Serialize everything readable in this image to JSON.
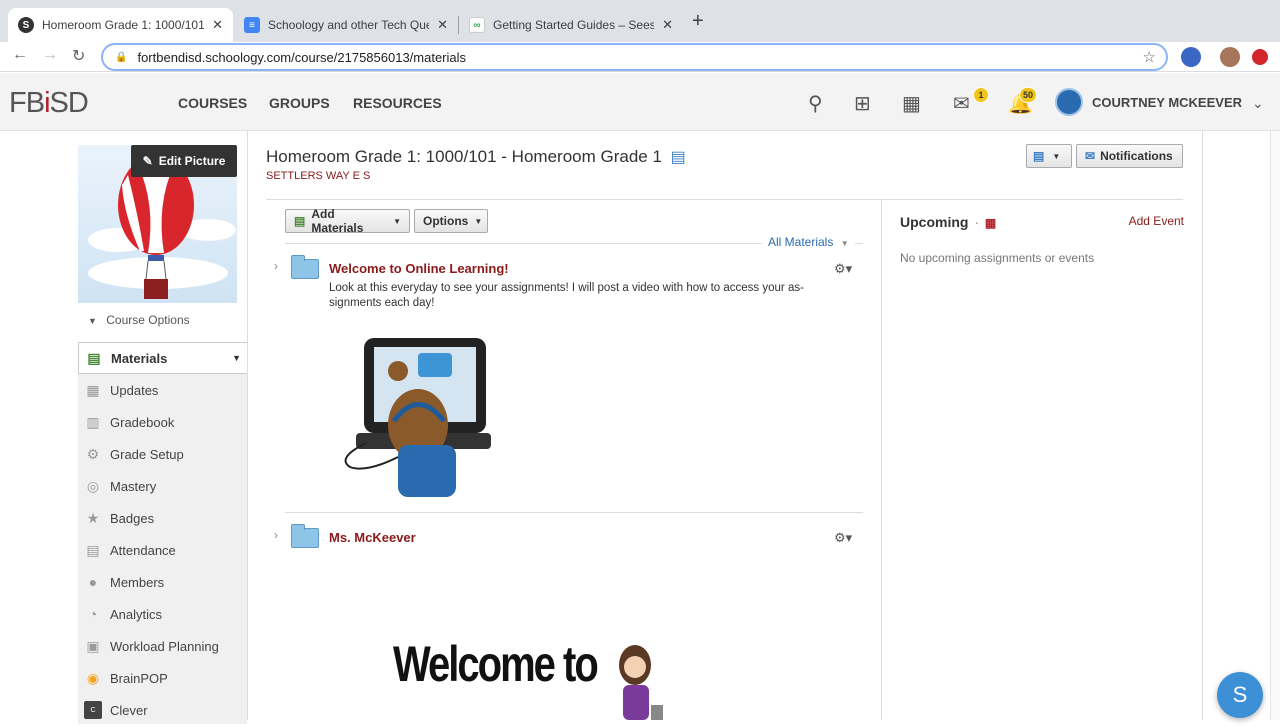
{
  "browser": {
    "tabs": [
      {
        "title": "Homeroom Grade 1: 1000/101 -",
        "favicon": "S",
        "favicon_color": "#1a73e8",
        "active": true
      },
      {
        "title": "Schoology and other Tech Que",
        "favicon": "doc",
        "favicon_color": "#4285f4",
        "active": false
      },
      {
        "title": "Getting Started Guides – Sees",
        "favicon": "seesaw",
        "favicon_color": "#34a853",
        "active": false
      }
    ],
    "url": "fortbendisd.schoology.com/course/2175856013/materials"
  },
  "header": {
    "logo_text_a": "FB",
    "logo_text_i": "i",
    "logo_text_b": "SD",
    "nav": [
      "COURSES",
      "GROUPS",
      "RESOURCES"
    ],
    "messages_badge": "1",
    "notifications_badge": "50",
    "user_name": "COURTNEY MCKEEVER"
  },
  "sidebar": {
    "edit_picture": "Edit Picture",
    "course_options": "Course Options",
    "items": [
      {
        "label": "Materials",
        "icon": "materials-icon"
      },
      {
        "label": "Updates",
        "icon": "updates-icon"
      },
      {
        "label": "Gradebook",
        "icon": "gradebook-icon"
      },
      {
        "label": "Grade Setup",
        "icon": "grade-setup-icon"
      },
      {
        "label": "Mastery",
        "icon": "mastery-icon"
      },
      {
        "label": "Badges",
        "icon": "badges-icon"
      },
      {
        "label": "Attendance",
        "icon": "attendance-icon"
      },
      {
        "label": "Members",
        "icon": "members-icon"
      },
      {
        "label": "Analytics",
        "icon": "analytics-icon"
      },
      {
        "label": "Workload Planning",
        "icon": "workload-icon"
      },
      {
        "label": "BrainPOP",
        "icon": "brainpop-icon"
      },
      {
        "label": "Clever",
        "icon": "clever-icon"
      }
    ]
  },
  "main": {
    "title": "Homeroom Grade 1: 1000/101 - Homeroom Grade 1",
    "subtitle": "SETTLERS WAY E S",
    "notifications_button": "Notifications",
    "add_materials": "Add Materials",
    "options": "Options",
    "filter": "All Materials",
    "folders": [
      {
        "title": "Welcome to Online Learning!",
        "description": "Look at this everyday to see your assignments! I will post a video with how to access your as-signments each day!"
      },
      {
        "title": "Ms. McKeever",
        "description": ""
      }
    ],
    "welcome_banner": "Welcome to"
  },
  "upcoming": {
    "title": "Upcoming",
    "add_event": "Add Event",
    "empty": "No upcoming assignments or events"
  },
  "fab_label": "S"
}
